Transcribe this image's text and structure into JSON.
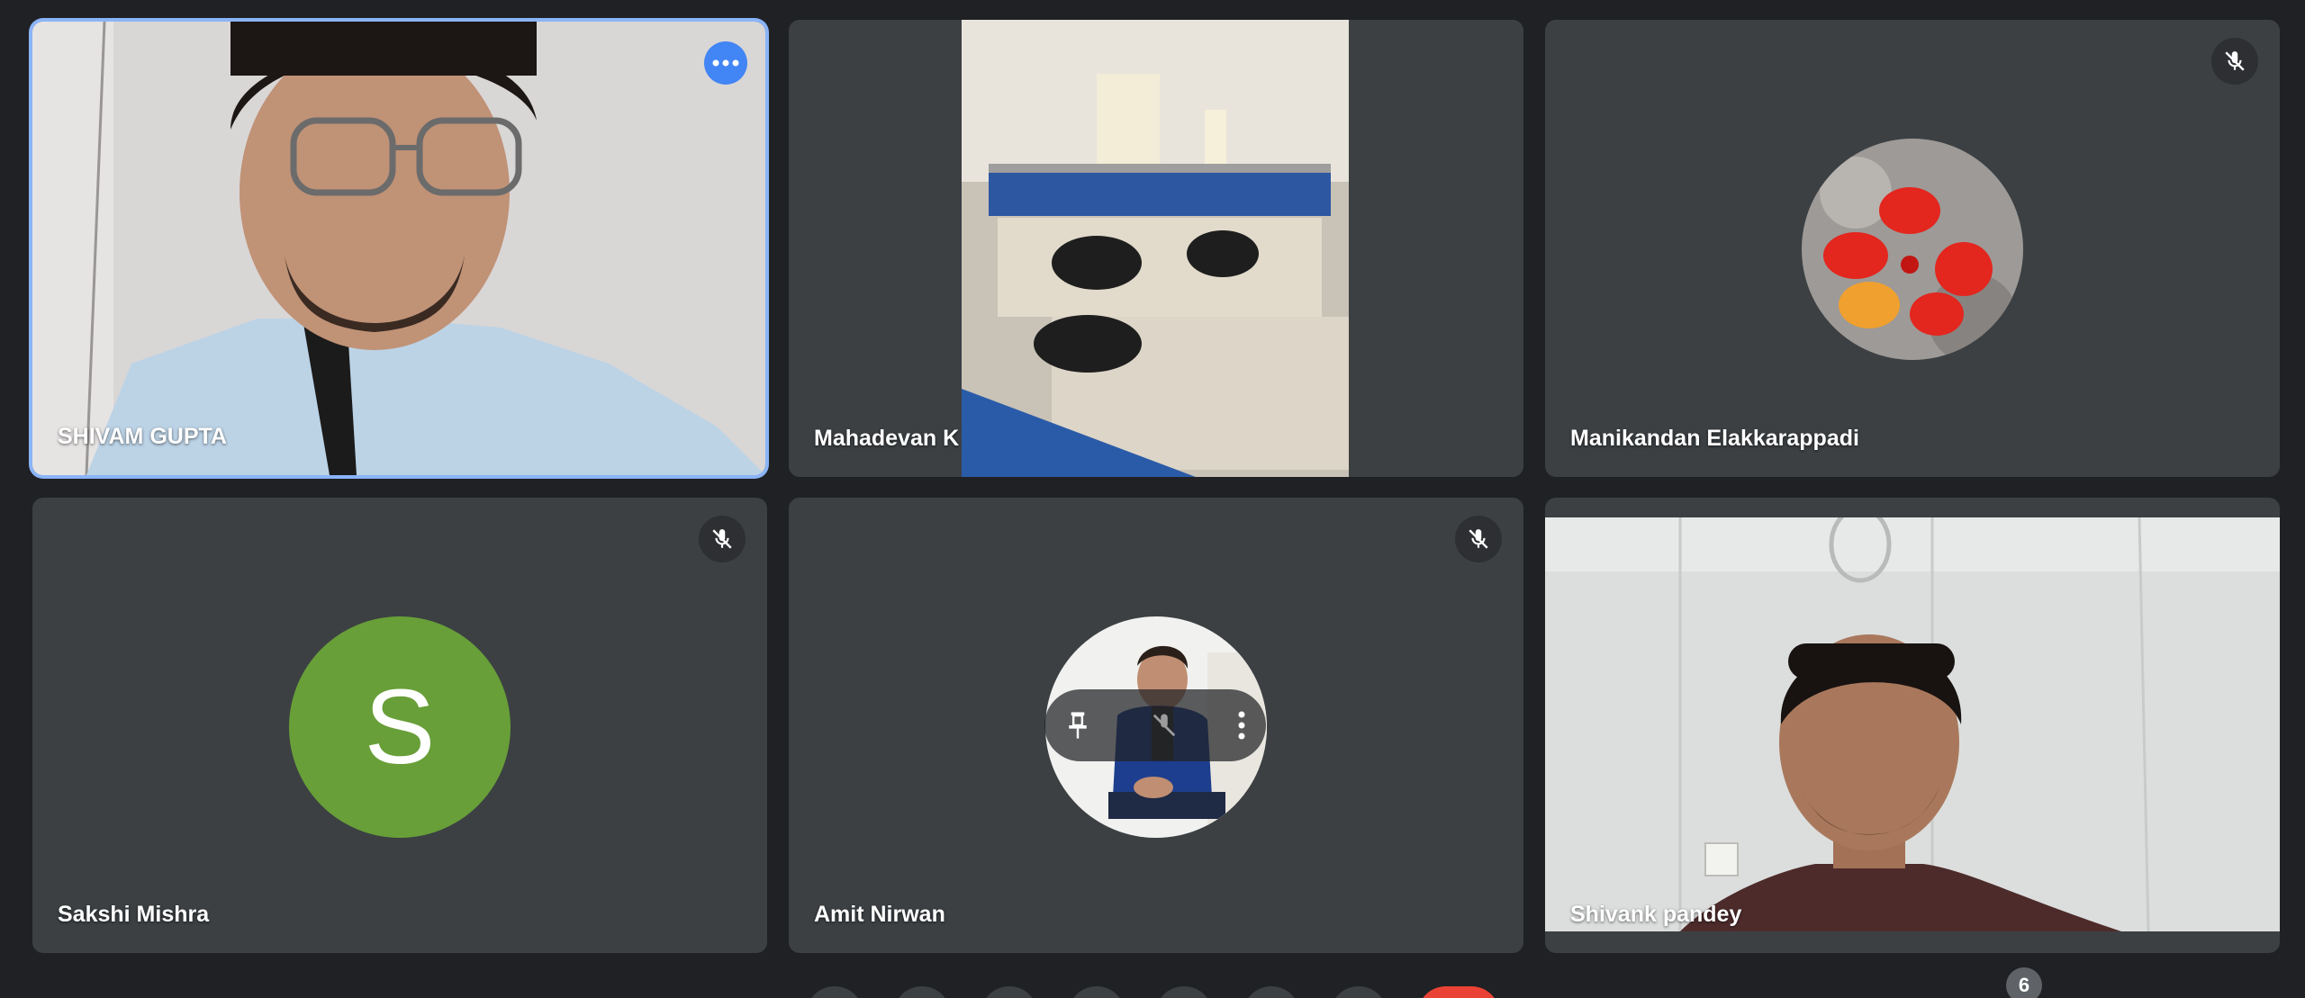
{
  "participants": [
    {
      "name": "SHIVAM GUPTA",
      "state": "video",
      "active": true
    },
    {
      "name": "Mahadevan K",
      "state": "video"
    },
    {
      "name": "Manikandan Elakkarappadi",
      "state": "photo-avatar",
      "muted": true
    },
    {
      "name": "Sakshi Mishra",
      "state": "letter-avatar",
      "initial": "S",
      "avatar_color": "#689f38",
      "muted": true
    },
    {
      "name": "Amit Nirwan",
      "state": "photo-avatar",
      "muted": true
    },
    {
      "name": "Shivank pandey",
      "state": "video"
    }
  ],
  "toolbar": {
    "participant_count": "6",
    "buttons": [
      "toolbar-button",
      "toolbar-button",
      "toolbar-button",
      "toolbar-button",
      "toolbar-button",
      "toolbar-button",
      "toolbar-button",
      "end-call-button"
    ]
  },
  "colors": {
    "background": "#202124",
    "tile": "#3c4043",
    "active_border": "#8ab4f8",
    "more_button": "#4285f4",
    "end_call": "#ea4335"
  },
  "icons": {
    "mic": "mic-off-icon",
    "more": "more-options-icon",
    "pin": "pin-icon"
  }
}
